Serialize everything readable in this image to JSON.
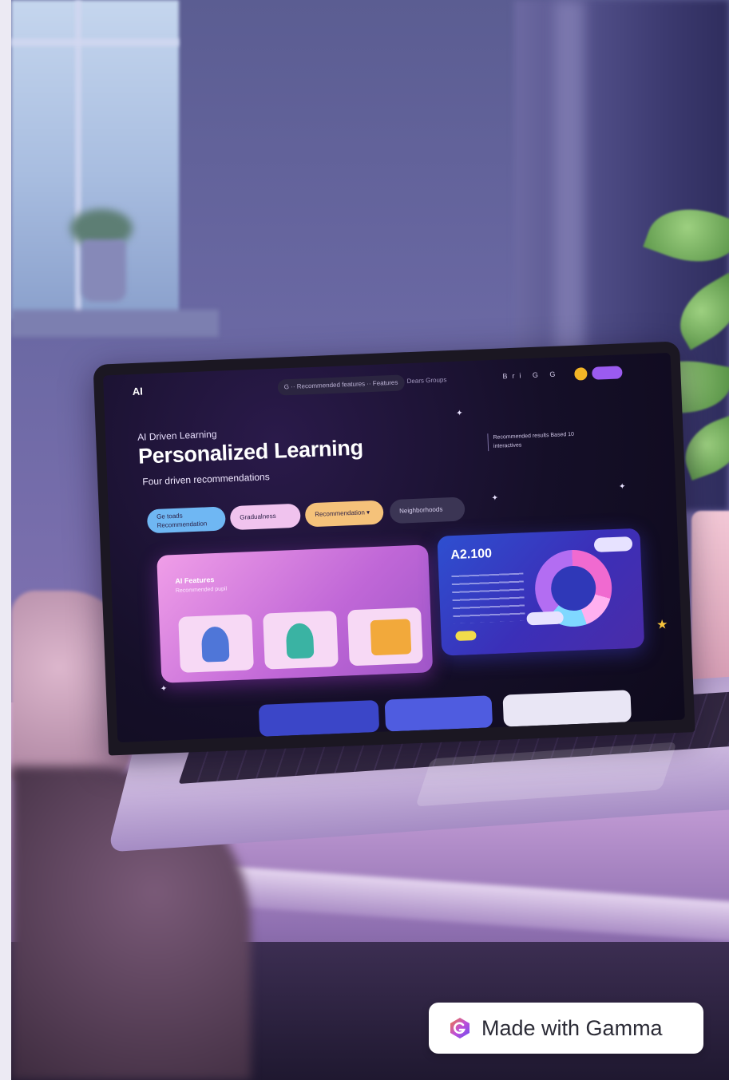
{
  "screen": {
    "nav": {
      "logo": "AI",
      "search_text": "G ·· Recommended features ·· Features",
      "links": "Dears   Groups",
      "icons": "Bri  G  G"
    },
    "hero": {
      "eyebrow": "AI Driven Learning",
      "title": "Personalized Learning",
      "subtitle": "Four driven recommendations",
      "side_note": "Recommended results Based 10 interactives"
    },
    "chips": [
      {
        "label": "Ge toads\nRecommendation"
      },
      {
        "label": "Gradualness"
      },
      {
        "label": "Recommendation ▾"
      },
      {
        "label": "Neighborhoods"
      }
    ],
    "card_left": {
      "title": "AI Features",
      "subtitle": "Recommended pupil"
    },
    "card_right": {
      "value": "A2.100"
    }
  },
  "badge": {
    "label": "Made with Gamma",
    "icon": "gamma-logo-icon"
  },
  "colors": {
    "badge_bg": "#ffffff",
    "gamma_purple": "#7b4cf0",
    "gamma_orange": "#f07a3a",
    "screen_bg": "#150f28",
    "card_pink": "#c067d7",
    "card_blue": "#2e4fd0"
  }
}
